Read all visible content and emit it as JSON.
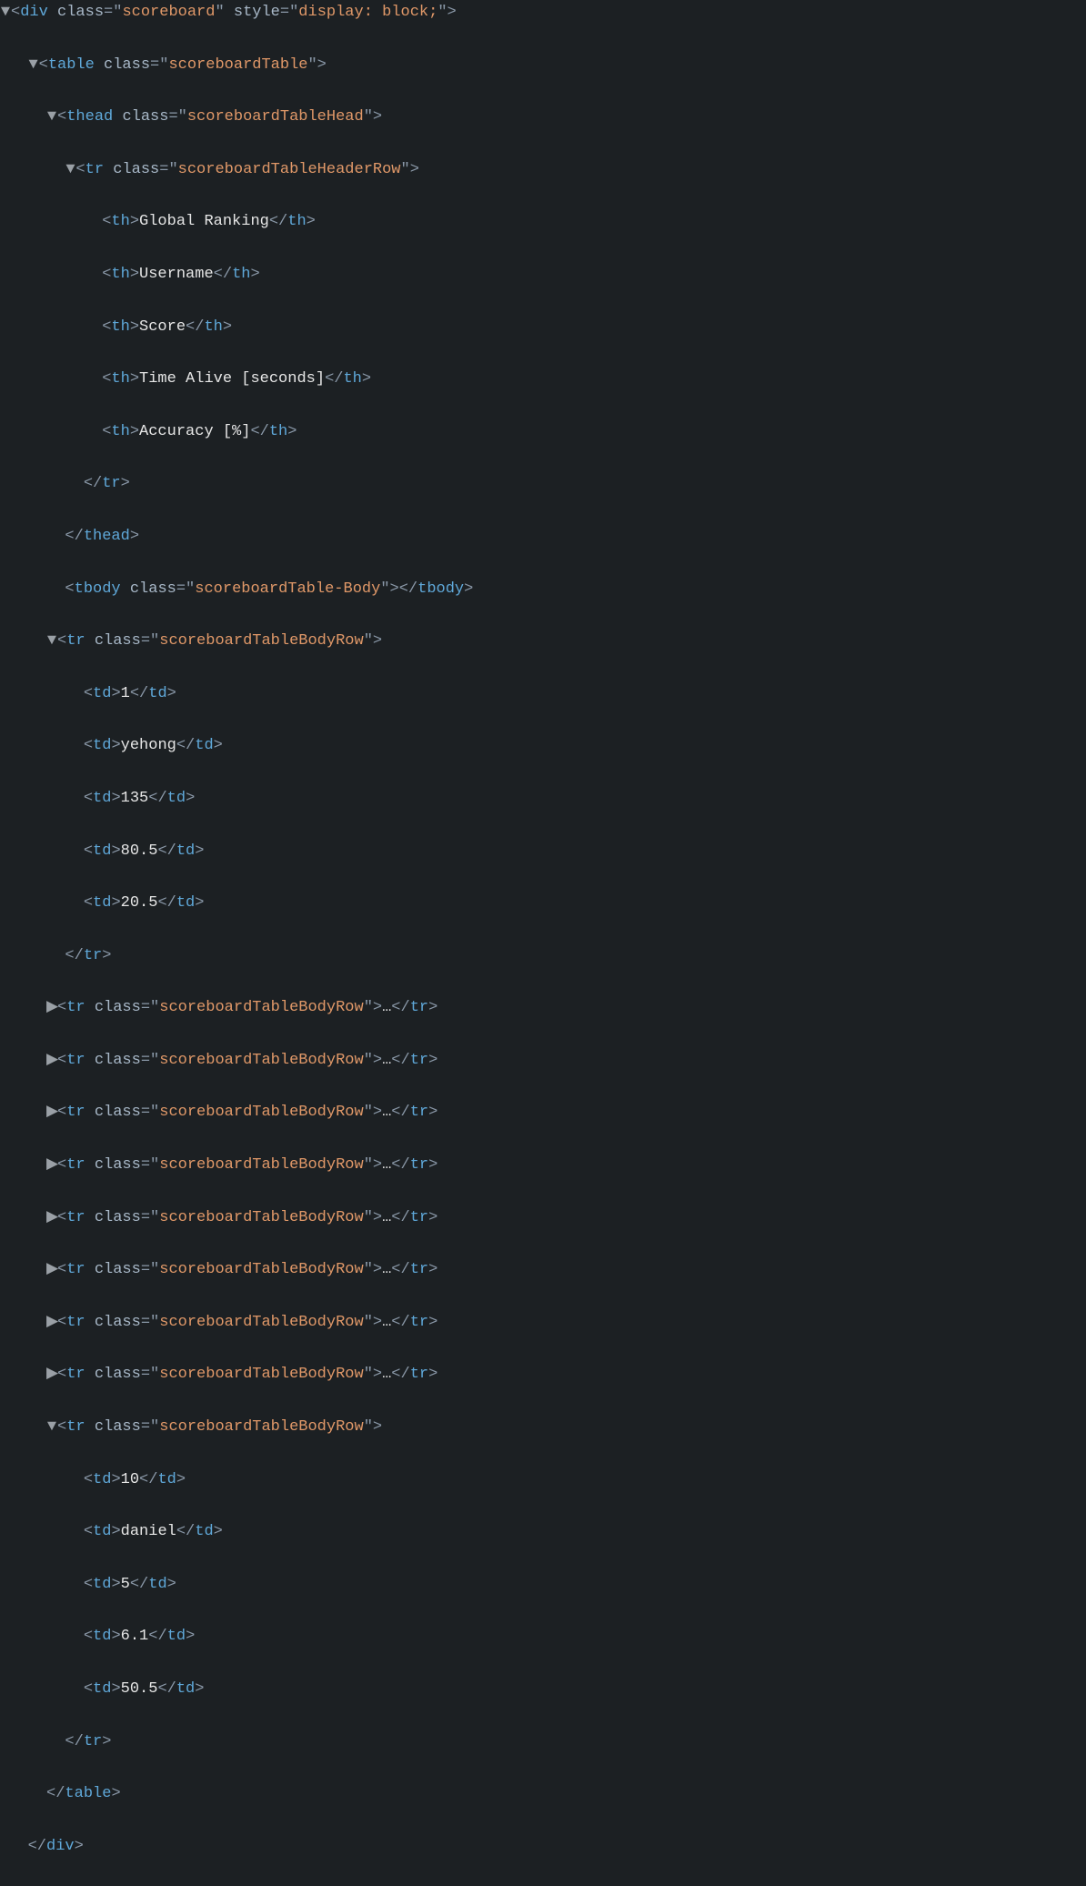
{
  "arrows": {
    "down": "▼",
    "right": "▶"
  },
  "tags": {
    "div": "div",
    "table": "table",
    "thead": "thead",
    "tbody": "tbody",
    "tr": "tr",
    "th": "th",
    "td": "td"
  },
  "attrs": {
    "class": "class",
    "style": "style"
  },
  "values": {
    "scoreboard": "scoreboard",
    "scoreboardTable": "scoreboardTable",
    "scoreboardTableHead": "scoreboardTableHead",
    "scoreboardTableHeaderRow": "scoreboardTableHeaderRow",
    "scoreboardTableBody": "scoreboardTable-Body",
    "scoreboardTableBodyRow": "scoreboardTableBodyRow",
    "displayBlock": "display: block;"
  },
  "headers": {
    "globalRanking": "Global Ranking",
    "username": "Username",
    "score": "Score",
    "timeAlive": "Time Alive [seconds]",
    "accuracy": "Accuracy [%]"
  },
  "row1": {
    "rank": "1",
    "username": "yehong",
    "score": "135",
    "timeAlive": "80.5",
    "accuracy": "20.5"
  },
  "row10": {
    "rank": "10",
    "username": "daniel",
    "score": "5",
    "timeAlive": "6.1",
    "accuracy": "50.5"
  },
  "ellipsis": "…"
}
